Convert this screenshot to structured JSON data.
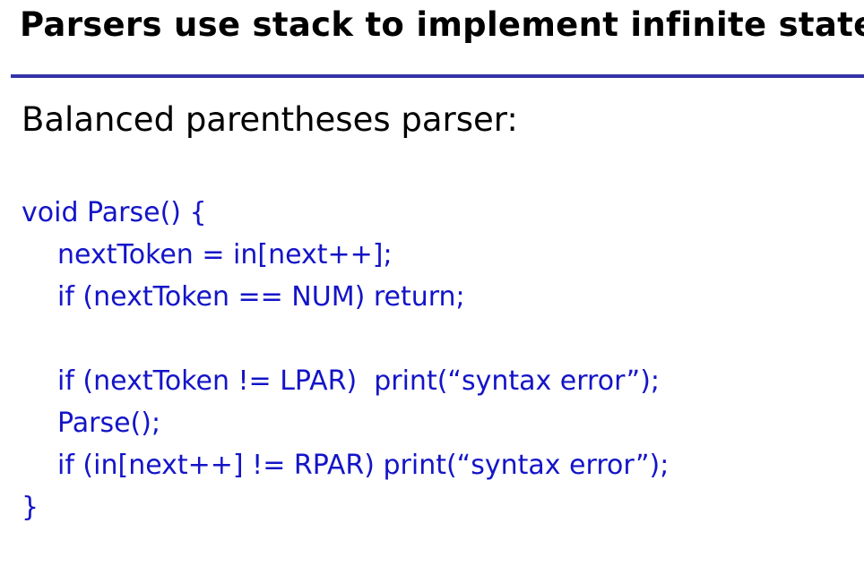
{
  "slide": {
    "title": "Parsers use stack to implement infinite state",
    "subtitle": "Balanced parentheses parser:",
    "colors": {
      "rule": "#3333a8",
      "code": "#1414c8",
      "text": "#000000"
    },
    "code": [
      {
        "text": "void Parse() {",
        "indent": 0
      },
      {
        "text": "nextToken = in[next++];",
        "indent": 1
      },
      {
        "text": "if (nextToken == NUM) return;",
        "indent": 1
      },
      {
        "text": "",
        "indent": 0
      },
      {
        "text": "if (nextToken != LPAR)  print(“syntax error”);",
        "indent": 1
      },
      {
        "text": "Parse();",
        "indent": 1
      },
      {
        "text": "if (in[next++] != RPAR) print(“syntax error”);",
        "indent": 1
      },
      {
        "text": "}",
        "indent": 0
      }
    ]
  }
}
